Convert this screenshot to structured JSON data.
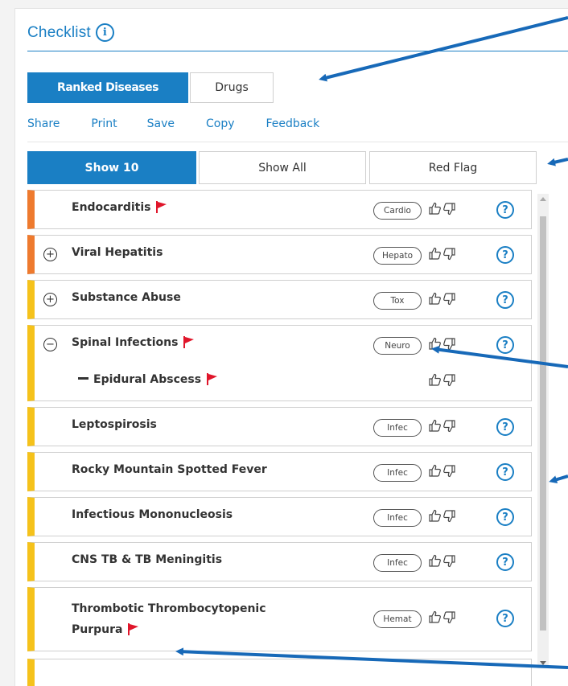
{
  "header": {
    "title": "Checklist",
    "info_icon": "info-icon"
  },
  "tabs": [
    {
      "label": "Ranked Diseases",
      "active": true
    },
    {
      "label": "Drugs",
      "active": false
    }
  ],
  "actions": [
    "Share",
    "Print",
    "Save",
    "Copy",
    "Feedback"
  ],
  "filters": [
    {
      "label": "Show 10",
      "active": true
    },
    {
      "label": "Show All",
      "active": false
    },
    {
      "label": "Red Flag",
      "active": false
    }
  ],
  "colors": {
    "accent": "#1a7fc4",
    "orange_bar": "#ee7a2e",
    "yellow_bar": "#f5c21b",
    "flag": "#e0162b",
    "annotation_arrow": "#1769b8"
  },
  "rows": [
    {
      "name": "Endocarditis",
      "tag": "Cardio",
      "flag": true
    },
    {
      "name": "Viral Hepatitis",
      "tag": "Hepato",
      "flag": false
    },
    {
      "name": "Substance Abuse",
      "tag": "Tox",
      "flag": false
    },
    {
      "name": "Spinal Infections",
      "tag": "Neuro",
      "flag": true,
      "sub": "Epidural Abscess"
    },
    {
      "name": "Leptospirosis",
      "tag": "Infec",
      "flag": false
    },
    {
      "name": "Rocky Mountain Spotted Fever",
      "tag": "Infec",
      "flag": false
    },
    {
      "name": "Infectious Mononucleosis",
      "tag": "Infec",
      "flag": false
    },
    {
      "name": "CNS TB & TB Meningitis",
      "tag": "Infec",
      "flag": false
    },
    {
      "name_line1": "Thrombotic Thrombocytopenic",
      "name_line2": "Purpura",
      "tag": "Hemat",
      "flag": true
    }
  ],
  "icons": {
    "help": "?",
    "expand": "+",
    "collapse": "−"
  }
}
